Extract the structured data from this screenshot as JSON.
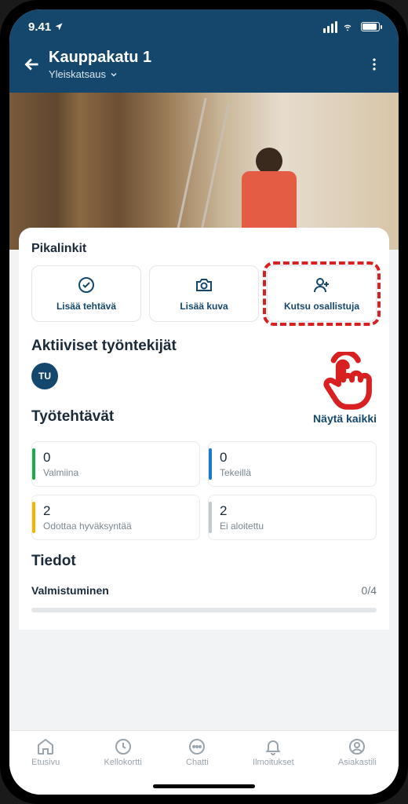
{
  "status": {
    "time": "9.41"
  },
  "header": {
    "title": "Kauppakatu 1",
    "subtitle": "Yleiskatsaus"
  },
  "quicklinks": {
    "heading": "Pikalinkit",
    "items": [
      {
        "label": "Lisää tehtävä"
      },
      {
        "label": "Lisää kuva"
      },
      {
        "label": "Kutsu osallistuja"
      }
    ]
  },
  "active_workers": {
    "heading": "Aktiiviset työntekijät",
    "initials": "TU"
  },
  "tasks": {
    "heading": "Työtehtävät",
    "show_all": "Näytä kaikki",
    "items": [
      {
        "count": "0",
        "label": "Valmiina",
        "color": "green"
      },
      {
        "count": "0",
        "label": "Tekeillä",
        "color": "blue"
      },
      {
        "count": "2",
        "label": "Odottaa hyväksyntää",
        "color": "yellow"
      },
      {
        "count": "2",
        "label": "Ei aloitettu",
        "color": "grey"
      }
    ]
  },
  "details": {
    "heading": "Tiedot",
    "completion_label": "Valmistuminen",
    "completion_value": "0/4"
  },
  "tabs": [
    {
      "label": "Etusivu"
    },
    {
      "label": "Kellokortti"
    },
    {
      "label": "Chatti"
    },
    {
      "label": "Ilmoitukset"
    },
    {
      "label": "Asiakastili"
    }
  ]
}
